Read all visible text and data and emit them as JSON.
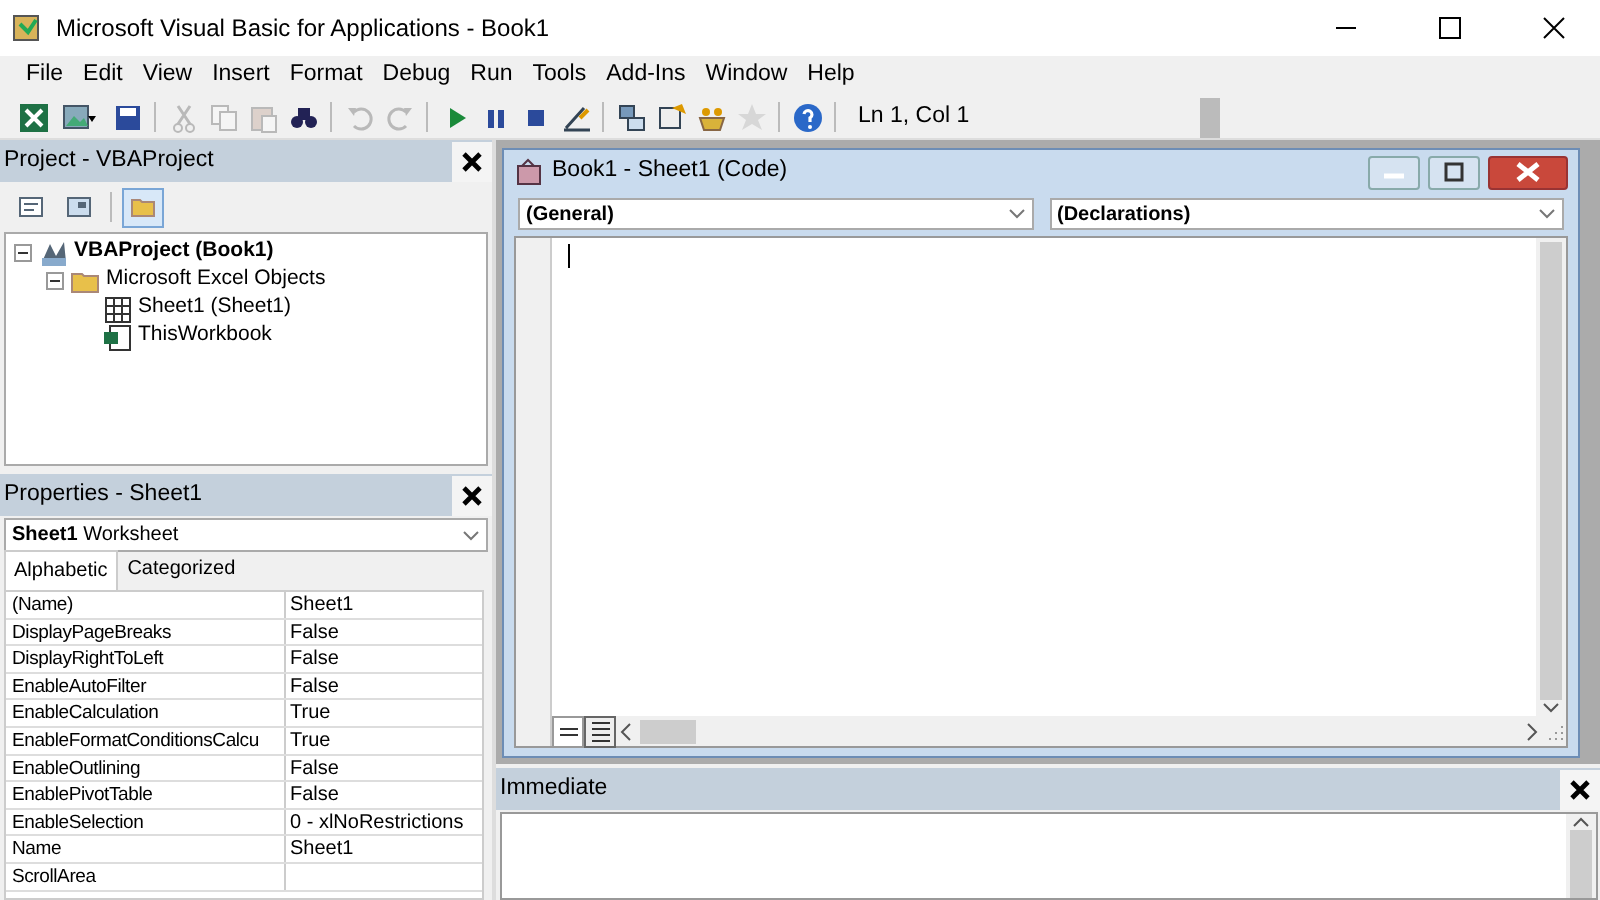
{
  "window": {
    "title": "Microsoft Visual Basic for Applications - Book1"
  },
  "menu": [
    "File",
    "Edit",
    "View",
    "Insert",
    "Format",
    "Debug",
    "Run",
    "Tools",
    "Add-Ins",
    "Window",
    "Help"
  ],
  "toolbar": {
    "buttons": [
      {
        "disabled": false
      },
      {
        "disabled": false
      },
      {
        "disabled": false
      },
      {
        "disabled": true
      },
      {
        "disabled": true
      },
      {
        "disabled": true
      },
      {
        "disabled": false
      },
      {
        "disabled": true
      },
      {
        "disabled": true
      },
      {
        "disabled": false
      },
      {
        "disabled": false
      },
      {
        "disabled": false
      },
      {
        "disabled": false
      },
      {
        "disabled": false
      },
      {
        "disabled": false
      },
      {
        "disabled": false
      },
      {
        "disabled": true
      },
      {
        "disabled": false
      }
    ],
    "position": "Ln 1, Col 1"
  },
  "project": {
    "title": "Project - VBAProject",
    "view_buttons": [
      {
        "selected": false
      },
      {
        "selected": false
      },
      {
        "selected": true
      }
    ],
    "tree": [
      {
        "label": "VBAProject (Book1)",
        "bold": true,
        "expanded": true,
        "children": [
          {
            "label": "Microsoft Excel Objects",
            "bold": false,
            "expanded": true,
            "children": [
              {
                "label": "Sheet1 (Sheet1)",
                "bold": false
              },
              {
                "label": "ThisWorkbook",
                "bold": false
              }
            ]
          }
        ]
      }
    ]
  },
  "properties": {
    "title": "Properties - Sheet1",
    "object": {
      "name": "Sheet1",
      "type": "Worksheet"
    },
    "tabs": [
      {
        "label": "Alphabetic",
        "selected": true
      },
      {
        "label": "Categorized",
        "selected": false
      }
    ],
    "rows": [
      {
        "name": "(Name)",
        "value": "Sheet1"
      },
      {
        "name": "DisplayPageBreaks",
        "value": "False"
      },
      {
        "name": "DisplayRightToLeft",
        "value": "False"
      },
      {
        "name": "EnableAutoFilter",
        "value": "False"
      },
      {
        "name": "EnableCalculation",
        "value": "True"
      },
      {
        "name": "EnableFormatConditionsCalcu",
        "value": "True"
      },
      {
        "name": "EnableOutlining",
        "value": "False"
      },
      {
        "name": "EnablePivotTable",
        "value": "False"
      },
      {
        "name": "EnableSelection",
        "value": "0 - xlNoRestrictions"
      },
      {
        "name": "Name",
        "value": "Sheet1"
      },
      {
        "name": "ScrollArea",
        "value": ""
      }
    ]
  },
  "code_window": {
    "title": "Book1 - Sheet1 (Code)",
    "object_combo": "(General)",
    "procedure_combo": "(Declarations)",
    "view_buttons": [
      {
        "selected": false
      },
      {
        "selected": true
      }
    ]
  },
  "immediate": {
    "title": "Immediate"
  }
}
